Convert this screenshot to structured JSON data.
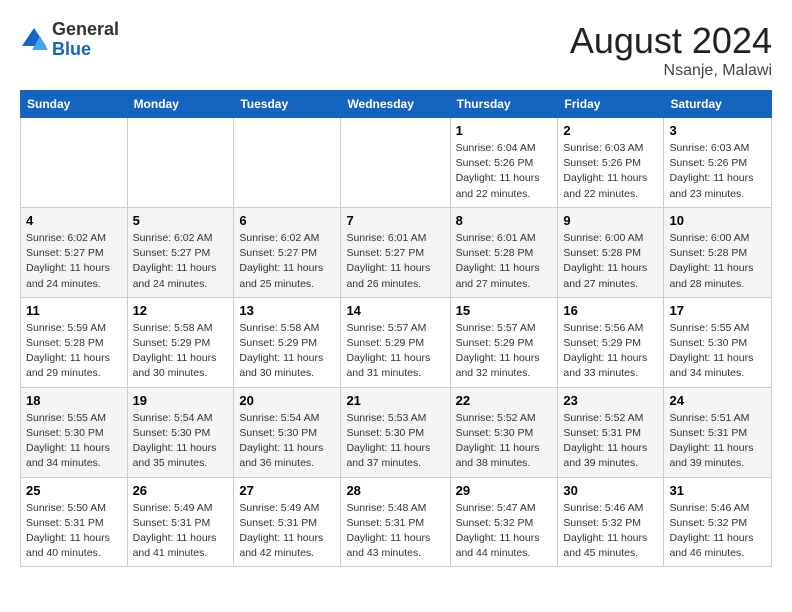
{
  "logo": {
    "general": "General",
    "blue": "Blue"
  },
  "title": {
    "month_year": "August 2024",
    "location": "Nsanje, Malawi"
  },
  "days_of_week": [
    "Sunday",
    "Monday",
    "Tuesday",
    "Wednesday",
    "Thursday",
    "Friday",
    "Saturday"
  ],
  "weeks": [
    [
      {
        "day": "",
        "info": ""
      },
      {
        "day": "",
        "info": ""
      },
      {
        "day": "",
        "info": ""
      },
      {
        "day": "",
        "info": ""
      },
      {
        "day": "1",
        "info": "Sunrise: 6:04 AM\nSunset: 5:26 PM\nDaylight: 11 hours\nand 22 minutes."
      },
      {
        "day": "2",
        "info": "Sunrise: 6:03 AM\nSunset: 5:26 PM\nDaylight: 11 hours\nand 22 minutes."
      },
      {
        "day": "3",
        "info": "Sunrise: 6:03 AM\nSunset: 5:26 PM\nDaylight: 11 hours\nand 23 minutes."
      }
    ],
    [
      {
        "day": "4",
        "info": "Sunrise: 6:02 AM\nSunset: 5:27 PM\nDaylight: 11 hours\nand 24 minutes."
      },
      {
        "day": "5",
        "info": "Sunrise: 6:02 AM\nSunset: 5:27 PM\nDaylight: 11 hours\nand 24 minutes."
      },
      {
        "day": "6",
        "info": "Sunrise: 6:02 AM\nSunset: 5:27 PM\nDaylight: 11 hours\nand 25 minutes."
      },
      {
        "day": "7",
        "info": "Sunrise: 6:01 AM\nSunset: 5:27 PM\nDaylight: 11 hours\nand 26 minutes."
      },
      {
        "day": "8",
        "info": "Sunrise: 6:01 AM\nSunset: 5:28 PM\nDaylight: 11 hours\nand 27 minutes."
      },
      {
        "day": "9",
        "info": "Sunrise: 6:00 AM\nSunset: 5:28 PM\nDaylight: 11 hours\nand 27 minutes."
      },
      {
        "day": "10",
        "info": "Sunrise: 6:00 AM\nSunset: 5:28 PM\nDaylight: 11 hours\nand 28 minutes."
      }
    ],
    [
      {
        "day": "11",
        "info": "Sunrise: 5:59 AM\nSunset: 5:28 PM\nDaylight: 11 hours\nand 29 minutes."
      },
      {
        "day": "12",
        "info": "Sunrise: 5:58 AM\nSunset: 5:29 PM\nDaylight: 11 hours\nand 30 minutes."
      },
      {
        "day": "13",
        "info": "Sunrise: 5:58 AM\nSunset: 5:29 PM\nDaylight: 11 hours\nand 30 minutes."
      },
      {
        "day": "14",
        "info": "Sunrise: 5:57 AM\nSunset: 5:29 PM\nDaylight: 11 hours\nand 31 minutes."
      },
      {
        "day": "15",
        "info": "Sunrise: 5:57 AM\nSunset: 5:29 PM\nDaylight: 11 hours\nand 32 minutes."
      },
      {
        "day": "16",
        "info": "Sunrise: 5:56 AM\nSunset: 5:29 PM\nDaylight: 11 hours\nand 33 minutes."
      },
      {
        "day": "17",
        "info": "Sunrise: 5:55 AM\nSunset: 5:30 PM\nDaylight: 11 hours\nand 34 minutes."
      }
    ],
    [
      {
        "day": "18",
        "info": "Sunrise: 5:55 AM\nSunset: 5:30 PM\nDaylight: 11 hours\nand 34 minutes."
      },
      {
        "day": "19",
        "info": "Sunrise: 5:54 AM\nSunset: 5:30 PM\nDaylight: 11 hours\nand 35 minutes."
      },
      {
        "day": "20",
        "info": "Sunrise: 5:54 AM\nSunset: 5:30 PM\nDaylight: 11 hours\nand 36 minutes."
      },
      {
        "day": "21",
        "info": "Sunrise: 5:53 AM\nSunset: 5:30 PM\nDaylight: 11 hours\nand 37 minutes."
      },
      {
        "day": "22",
        "info": "Sunrise: 5:52 AM\nSunset: 5:30 PM\nDaylight: 11 hours\nand 38 minutes."
      },
      {
        "day": "23",
        "info": "Sunrise: 5:52 AM\nSunset: 5:31 PM\nDaylight: 11 hours\nand 39 minutes."
      },
      {
        "day": "24",
        "info": "Sunrise: 5:51 AM\nSunset: 5:31 PM\nDaylight: 11 hours\nand 39 minutes."
      }
    ],
    [
      {
        "day": "25",
        "info": "Sunrise: 5:50 AM\nSunset: 5:31 PM\nDaylight: 11 hours\nand 40 minutes."
      },
      {
        "day": "26",
        "info": "Sunrise: 5:49 AM\nSunset: 5:31 PM\nDaylight: 11 hours\nand 41 minutes."
      },
      {
        "day": "27",
        "info": "Sunrise: 5:49 AM\nSunset: 5:31 PM\nDaylight: 11 hours\nand 42 minutes."
      },
      {
        "day": "28",
        "info": "Sunrise: 5:48 AM\nSunset: 5:31 PM\nDaylight: 11 hours\nand 43 minutes."
      },
      {
        "day": "29",
        "info": "Sunrise: 5:47 AM\nSunset: 5:32 PM\nDaylight: 11 hours\nand 44 minutes."
      },
      {
        "day": "30",
        "info": "Sunrise: 5:46 AM\nSunset: 5:32 PM\nDaylight: 11 hours\nand 45 minutes."
      },
      {
        "day": "31",
        "info": "Sunrise: 5:46 AM\nSunset: 5:32 PM\nDaylight: 11 hours\nand 46 minutes."
      }
    ]
  ]
}
